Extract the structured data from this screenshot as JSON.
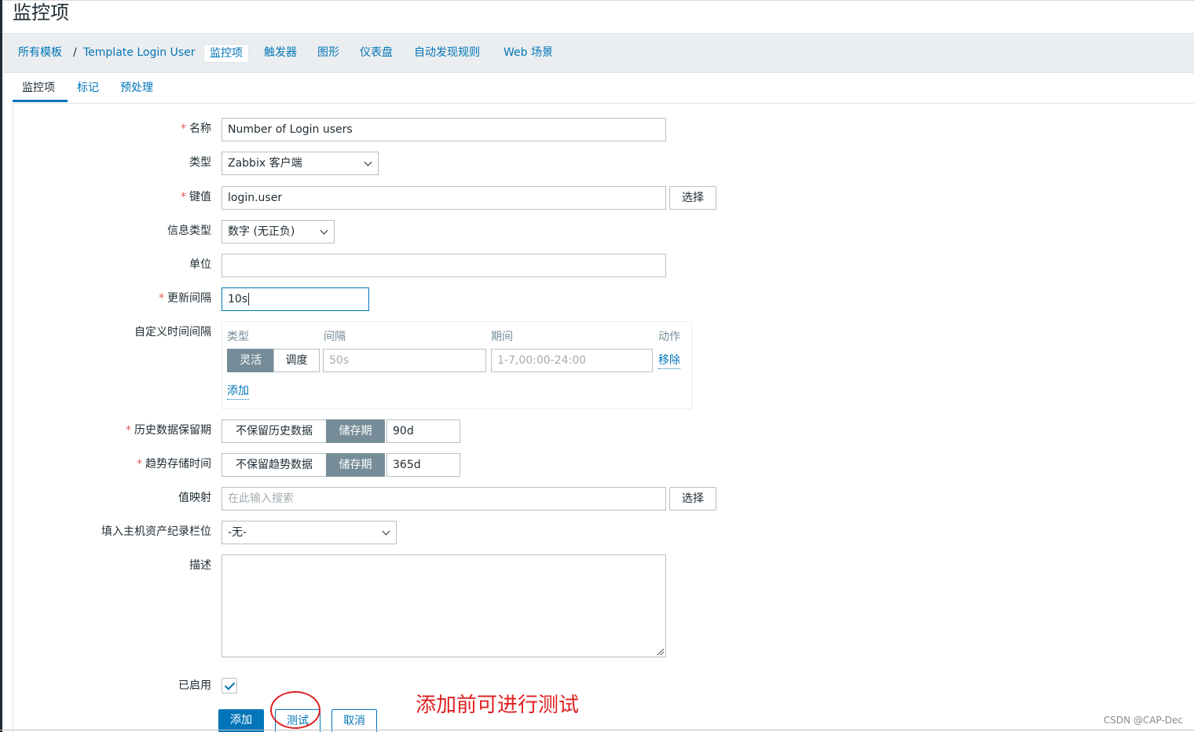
{
  "page": {
    "title": "监控项"
  },
  "nav": {
    "all_templates": "所有模板",
    "separator": "/",
    "template_name": "Template Login User",
    "tabs": [
      "监控项",
      "触发器",
      "图形",
      "仪表盘",
      "自动发现规则",
      "Web 场景"
    ]
  },
  "subtabs": [
    "监控项",
    "标记",
    "预处理"
  ],
  "form": {
    "name_label": "名称",
    "name_value": "Number of Login users",
    "type_label": "类型",
    "type_value": "Zabbix 客户端",
    "key_label": "键值",
    "key_value": "login.user",
    "key_select": "选择",
    "info_type_label": "信息类型",
    "info_type_value": "数字 (无正负)",
    "unit_label": "单位",
    "unit_value": "",
    "interval_label": "更新间隔",
    "interval_value": "10s",
    "custom_intervals": {
      "label": "自定义时间间隔",
      "col_type": "类型",
      "col_interval": "间隔",
      "col_period": "期间",
      "col_action": "动作",
      "seg_flexible": "灵活",
      "seg_scheduling": "调度",
      "interval_placeholder": "50s",
      "period_placeholder": "1-7,00:00-24:00",
      "remove": "移除",
      "add": "添加"
    },
    "history": {
      "label": "历史数据保留期",
      "no_keep": "不保留历史数据",
      "storage": "储存期",
      "value": "90d"
    },
    "trends": {
      "label": "趋势存储时间",
      "no_keep": "不保留趋势数据",
      "storage": "储存期",
      "value": "365d"
    },
    "valuemap_label": "值映射",
    "valuemap_placeholder": "在此输入搜索",
    "valuemap_select": "选择",
    "inventory_label": "填入主机资产纪录栏位",
    "inventory_value": "-无-",
    "description_label": "描述",
    "enabled_label": "已启用"
  },
  "buttons": {
    "add": "添加",
    "test": "测试",
    "cancel": "取消"
  },
  "annotation": {
    "text": "添加前可进行测试"
  },
  "watermark": "CSDN @CAP-Dec",
  "colors": {
    "link": "#0275b8",
    "annotation": "#e02020",
    "segment_on": "#768d99"
  }
}
